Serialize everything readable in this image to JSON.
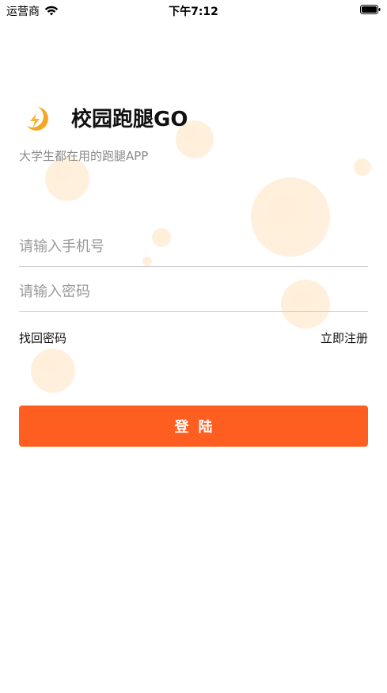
{
  "status_bar": {
    "carrier": "运营商",
    "time": "下午7:12"
  },
  "header": {
    "logo_icon": "lightning-moon-logo-icon",
    "title": "校园跑腿GO",
    "subtitle": "大学生都在用的跑腿APP"
  },
  "form": {
    "phone_placeholder": "请输入手机号",
    "phone_value": "",
    "password_placeholder": "请输入密码",
    "password_value": "",
    "forgot_password": "找回密码",
    "register": "立即注册",
    "login_button": "登陆"
  },
  "colors": {
    "accent": "#ff5e21",
    "logo": "#f5a623"
  }
}
